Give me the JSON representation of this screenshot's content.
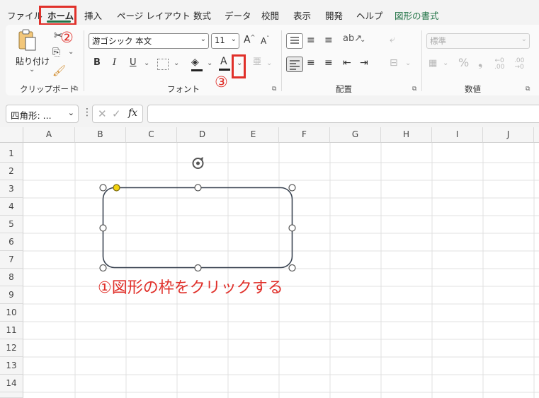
{
  "menu": {
    "tabs": [
      {
        "label": "ファイル"
      },
      {
        "label": "ホーム"
      },
      {
        "label": "挿入"
      },
      {
        "label": "ページ レイアウト"
      },
      {
        "label": "数式"
      },
      {
        "label": "データ"
      },
      {
        "label": "校閲"
      },
      {
        "label": "表示"
      },
      {
        "label": "開発"
      },
      {
        "label": "ヘルプ"
      },
      {
        "label": "図形の書式"
      }
    ]
  },
  "annotations": {
    "step1": "①図形の枠をクリックする",
    "step2": "②",
    "step3": "③",
    "accent_color": "#e0302a"
  },
  "ribbon": {
    "clipboard": {
      "paste_label": "貼り付け",
      "group_label": "クリップボード"
    },
    "font": {
      "font_name": "游ゴシック 本文",
      "font_size": "11",
      "group_label": "フォント"
    },
    "alignment": {
      "group_label": "配置"
    },
    "number": {
      "format": "標準",
      "group_label": "数値"
    }
  },
  "formula_bar": {
    "name_box": "四角形: ...",
    "fx": "fx",
    "value": ""
  },
  "grid": {
    "columns": [
      "A",
      "B",
      "C",
      "D",
      "E",
      "F",
      "G",
      "H",
      "I",
      "J"
    ],
    "rows": [
      "1",
      "2",
      "3",
      "4",
      "5",
      "6",
      "7",
      "8",
      "9",
      "10",
      "11",
      "12",
      "13",
      "14"
    ]
  },
  "colors": {
    "accent_green": "#217346",
    "highlight_red": "#e0302a",
    "adjust_handle": "#f2d20f"
  }
}
